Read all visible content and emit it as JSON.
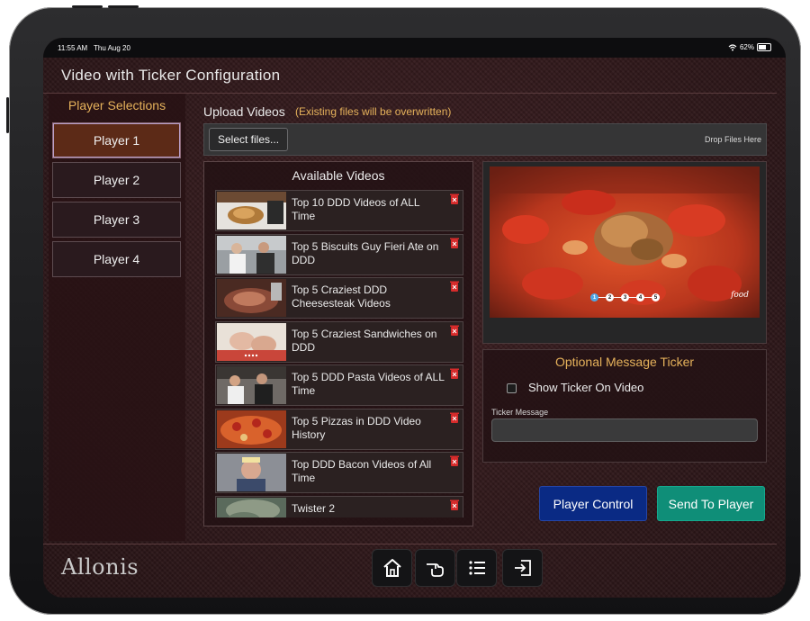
{
  "status_bar": {
    "time": "11:55 AM",
    "date": "Thu Aug 20",
    "battery": "62%"
  },
  "page": {
    "title": "Video with Ticker Configuration"
  },
  "sidebar": {
    "title": "Player Selections",
    "players": [
      {
        "label": "Player 1",
        "active": true
      },
      {
        "label": "Player 2",
        "active": false
      },
      {
        "label": "Player 3",
        "active": false
      },
      {
        "label": "Player 4",
        "active": false
      }
    ]
  },
  "upload": {
    "label": "Upload Videos",
    "note": "(Existing files will be overwritten)",
    "select_button": "Select files...",
    "drop_text": "Drop Files Here"
  },
  "videos": {
    "title": "Available Videos",
    "items": [
      {
        "name": "Top 10 DDD Videos of ALL Time",
        "thumb": "sandwich"
      },
      {
        "name": "Top 5 Biscuits Guy Fieri Ate on DDD",
        "thumb": "kitchen"
      },
      {
        "name": "Top 5 Craziest DDD Cheesesteak Videos",
        "thumb": "meat"
      },
      {
        "name": "Top 5 Craziest Sandwiches on DDD",
        "thumb": "hands"
      },
      {
        "name": "Top 5 DDD Pasta Videos of ALL Time",
        "thumb": "chefs"
      },
      {
        "name": "Top 5 Pizzas in DDD Video History",
        "thumb": "pizza"
      },
      {
        "name": "Top DDD Bacon Videos of All Time",
        "thumb": "guy"
      },
      {
        "name": "Twister 2",
        "thumb": "storm"
      }
    ]
  },
  "preview": {
    "dots": [
      "1",
      "2",
      "3",
      "4",
      "5"
    ],
    "active_dot": 1,
    "brand": "food"
  },
  "ticker": {
    "title": "Optional Message Ticker",
    "show_label": "Show Ticker On Video",
    "show_checked": false,
    "message_label": "Ticker Message",
    "message_value": ""
  },
  "actions": {
    "player_control": "Player Control",
    "send_to_player": "Send To Player"
  },
  "footer": {
    "logo": "Allonis",
    "nav": [
      {
        "icon": "home-icon"
      },
      {
        "icon": "remote-hand-icon"
      },
      {
        "icon": "list-icon"
      },
      {
        "icon": "logout-icon"
      }
    ]
  },
  "colors": {
    "accent_gold": "#e6b25b",
    "player_control": "#0a2a84",
    "send_to_player": "#0f8e78",
    "active_player": "#5c2a17"
  }
}
